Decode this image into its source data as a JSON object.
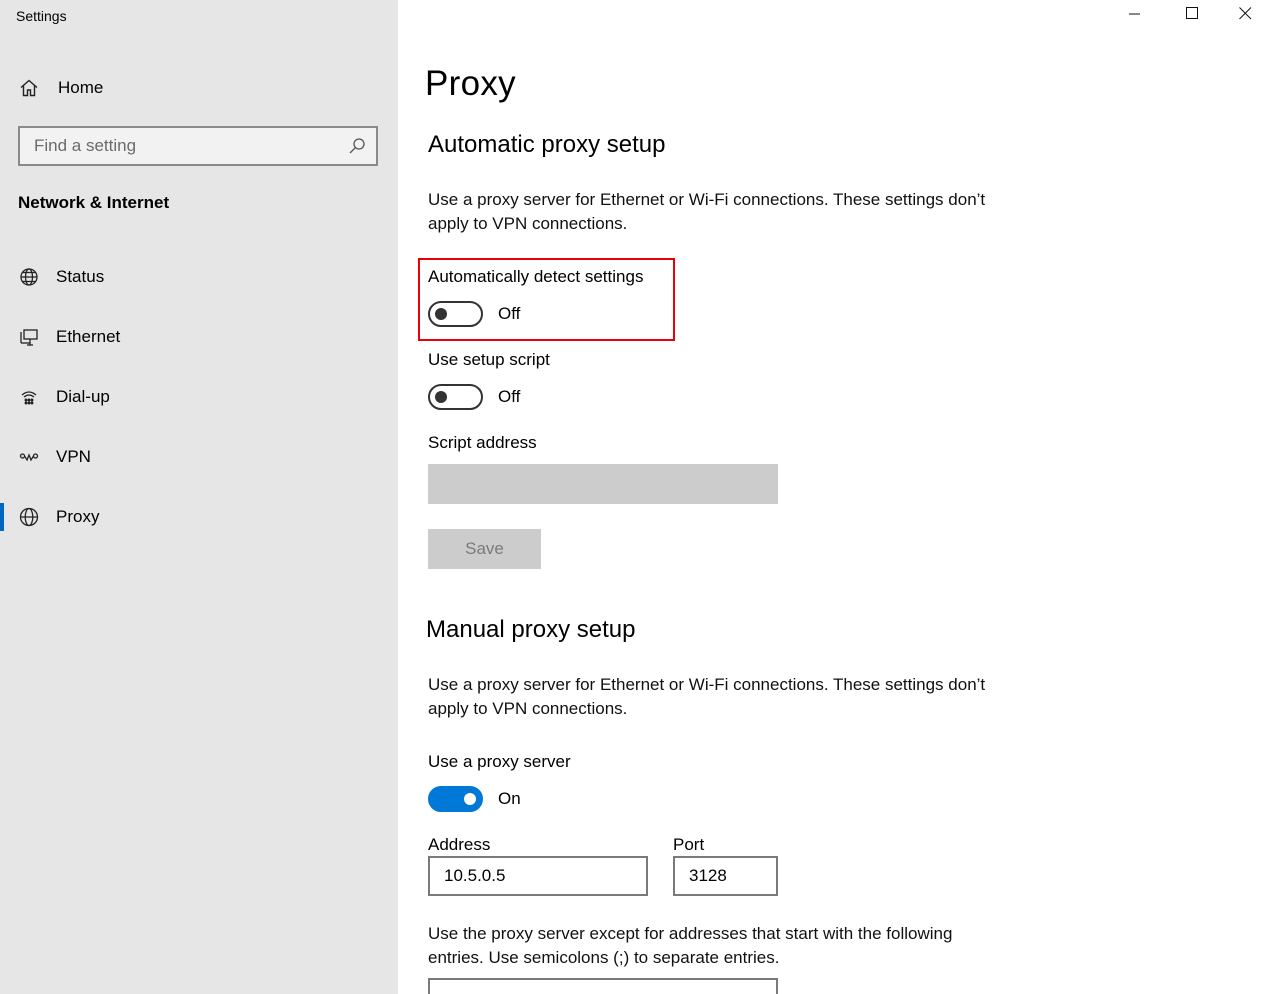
{
  "window": {
    "title": "Settings",
    "controls": {
      "minimize": "minimize-icon",
      "maximize": "maximize-icon",
      "close": "close-icon"
    }
  },
  "sidebar": {
    "home_label": "Home",
    "search_placeholder": "Find a setting",
    "section_title": "Network & Internet",
    "items": [
      {
        "label": "Status",
        "icon": "globe-status-icon"
      },
      {
        "label": "Ethernet",
        "icon": "ethernet-icon"
      },
      {
        "label": "Dial-up",
        "icon": "dialup-icon"
      },
      {
        "label": "VPN",
        "icon": "vpn-icon"
      },
      {
        "label": "Proxy",
        "icon": "globe-icon",
        "active": true
      }
    ],
    "accent": "#0067c0"
  },
  "main": {
    "title": "Proxy",
    "auto": {
      "heading": "Automatic proxy setup",
      "description": "Use a proxy server for Ethernet or Wi-Fi connections. These settings don’t apply to VPN connections.",
      "detect_label": "Automatically detect settings",
      "detect_state": "Off",
      "script_label": "Use setup script",
      "script_state": "Off",
      "script_address_label": "Script address",
      "script_address_value": "",
      "save_label": "Save"
    },
    "manual": {
      "heading": "Manual proxy setup",
      "description": "Use a proxy server for Ethernet or Wi-Fi connections. These settings don’t apply to VPN connections.",
      "use_proxy_label": "Use a proxy server",
      "use_proxy_state": "On",
      "address_label": "Address",
      "address_value": "10.5.0.5",
      "port_label": "Port",
      "port_value": "3128",
      "exceptions_text": "Use the proxy server except for addresses that start with the following entries. Use semicolons (;) to separate entries."
    },
    "toggle_on_color": "#0078d7",
    "highlight_color": "#e8000b"
  }
}
